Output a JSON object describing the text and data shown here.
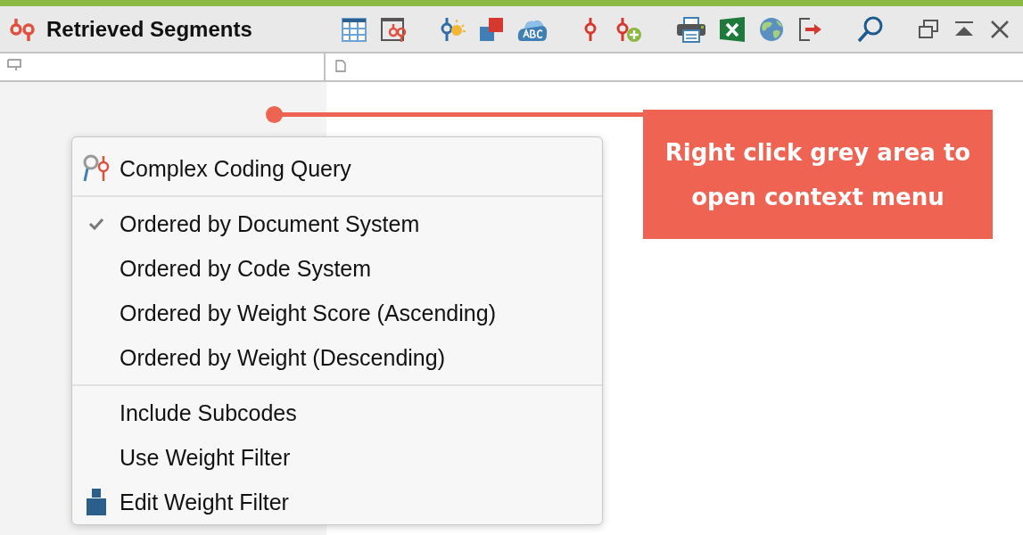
{
  "window": {
    "title": "Retrieved Segments"
  },
  "context_menu": {
    "sections": [
      {
        "items": [
          {
            "label": "Complex Coding Query",
            "kind": "query",
            "checked": false
          }
        ]
      },
      {
        "items": [
          {
            "label": "Ordered by Document System",
            "checked": true
          },
          {
            "label": "Ordered by Code System",
            "checked": false
          },
          {
            "label": "Ordered by Weight Score (Ascending)",
            "checked": false
          },
          {
            "label": "Ordered by Weight (Descending)",
            "checked": false
          }
        ]
      },
      {
        "items": [
          {
            "label": "Include Subcodes",
            "checked": false
          },
          {
            "label": "Use Weight Filter",
            "checked": false
          },
          {
            "label": "Edit Weight Filter",
            "kind": "weight",
            "checked": false
          }
        ]
      }
    ]
  },
  "callout": {
    "text": "Right click grey area to open context menu"
  }
}
